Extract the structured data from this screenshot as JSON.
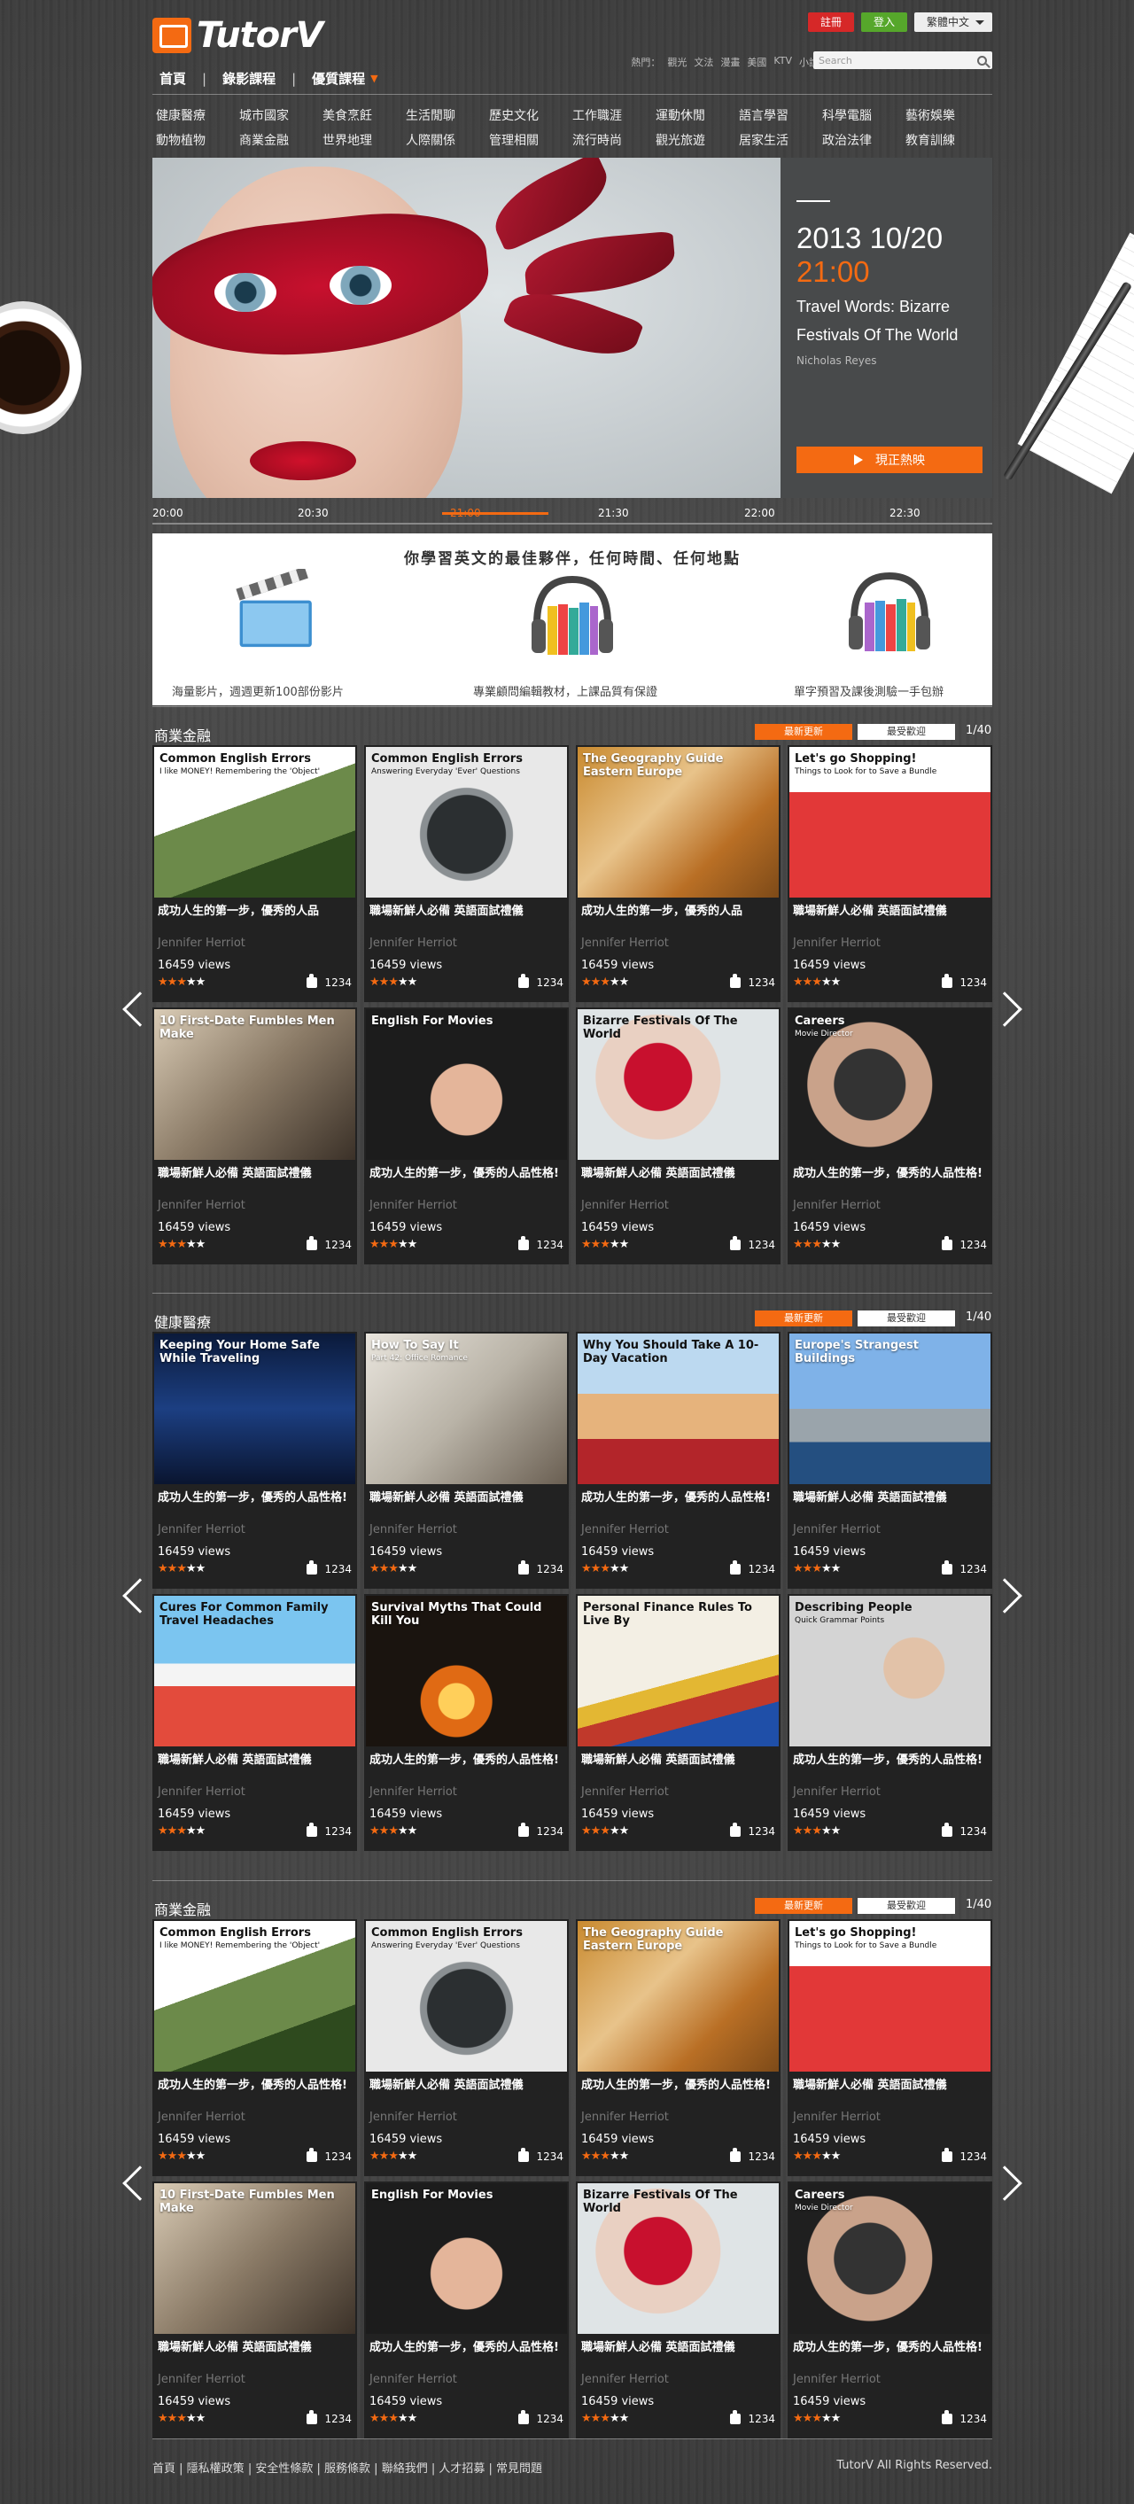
{
  "brand": {
    "name": "TutorV"
  },
  "header": {
    "register": "註冊",
    "login": "登入",
    "language": "繁體中文",
    "nav": [
      "首頁",
      "錄影課程",
      "優質課程"
    ],
    "hot_label": "熱門：",
    "hot_links": [
      "觀光",
      "文法",
      "漫畫",
      "美國",
      "KTV",
      "小說"
    ],
    "search_placeholder": "Search"
  },
  "categories": [
    "健康醫療",
    "城市國家",
    "美食烹飪",
    "生活閒聊",
    "歷史文化",
    "工作職涯",
    "運動休閒",
    "語言學習",
    "科學電腦",
    "藝術娛樂",
    "動物植物",
    "商業金融",
    "世界地理",
    "人際關係",
    "管理相關",
    "流行時尚",
    "觀光旅遊",
    "居家生活",
    "政治法律",
    "教育訓練"
  ],
  "hero": {
    "date": "2013 10/20",
    "time": "21:00",
    "title": "Travel Words: Bizarre Festivals Of The World",
    "author": "Nicholas Reyes",
    "button": "現正熱映",
    "timeline": [
      "20:00",
      "20:30",
      "21:00",
      "21:30",
      "22:00",
      "22:30"
    ],
    "timeline_active": 2
  },
  "banner": {
    "title": "你學習英文的最佳夥伴，任何時間、任何地點",
    "features": [
      "海量影片，週週更新100部份影片",
      "專業顧問編輯教材，上課品質有保證",
      "單字預習及課後測驗一手包辦"
    ]
  },
  "tabs": {
    "latest": "最新更新",
    "popular": "最受歡迎",
    "pager": "1/40"
  },
  "card_common": {
    "desc_a": "成功人生的第一步，優秀的人品性格!",
    "desc_b": "職場新鮮人必備 英語面試禮儀",
    "author": "Jennifer Herriot",
    "views": "16459 views",
    "likes": "1234",
    "rating": 3
  },
  "sections": [
    {
      "title": "商業金融",
      "cards": [
        {
          "title": "Common English Errors",
          "sub": "I like MONEY! Remembering the 'Object'",
          "desc": "成功人生的第一步，優秀的人品",
          "theme": "wave",
          "dark": true
        },
        {
          "title": "Common English Errors",
          "sub": "Answering Everyday 'Ever' Questions",
          "desc": "職場新鮮人必備 英語面試禮儀",
          "theme": "clock",
          "dark": true
        },
        {
          "title": "The Geography Guide Eastern Europe",
          "sub": "",
          "desc": "成功人生的第一步，優秀的人品",
          "theme": "map",
          "dark": false
        },
        {
          "title": "Let's go Shopping!",
          "sub": "Things to Look for to Save a Bundle",
          "desc": "職場新鮮人必備 英語面試禮儀",
          "theme": "shop",
          "dark": true
        },
        {
          "title": "10 First-Date Fumbles Men Make",
          "sub": "",
          "desc": "職場新鮮人必備 英語面試禮儀",
          "theme": "date",
          "dark": false
        },
        {
          "title": "English For Movies",
          "sub": "",
          "desc": "成功人生的第一步，優秀的人品性格!",
          "theme": "movie",
          "dark": false
        },
        {
          "title": "Bizarre Festivals Of The World",
          "sub": "",
          "desc": "職場新鮮人必備 英語面試禮儀",
          "theme": "mask",
          "dark": true
        },
        {
          "title": "Careers",
          "sub": "Movie Director",
          "desc": "成功人生的第一步，優秀的人品性格!",
          "theme": "camera",
          "dark": false
        }
      ]
    },
    {
      "title": "健康醫療",
      "cards": [
        {
          "title": "Keeping Your Home Safe While Traveling",
          "sub": "",
          "desc": "成功人生的第一步，優秀的人品性格!",
          "theme": "night",
          "dark": false
        },
        {
          "title": "How To Say It",
          "sub": "Part 42: Office Romance",
          "desc": "職場新鮮人必備 英語面試禮儀",
          "theme": "office",
          "dark": false
        },
        {
          "title": "Why You Should Take A 10-Day Vacation",
          "sub": "",
          "desc": "成功人生的第一步，優秀的人品性格!",
          "theme": "car",
          "dark": true
        },
        {
          "title": "Europe's Strangest Buildings",
          "sub": "",
          "desc": "職場新鮮人必備 英語面試禮儀",
          "theme": "building",
          "dark": false
        },
        {
          "title": "Cures For Common Family Travel Headaches",
          "sub": "",
          "desc": "職場新鮮人必備 英語面試禮儀",
          "theme": "family",
          "dark": true
        },
        {
          "title": "Survival Myths That Could Kill You",
          "sub": "",
          "desc": "成功人生的第一步，優秀的人品性格!",
          "theme": "fire",
          "dark": false
        },
        {
          "title": "Personal Finance Rules To Live By",
          "sub": "",
          "desc": "職場新鮮人必備 英語面試禮儀",
          "theme": "chart",
          "dark": true
        },
        {
          "title": "Describing People",
          "sub": "Quick Grammar Points",
          "desc": "成功人生的第一步，優秀的人品性格!",
          "theme": "man",
          "dark": true
        }
      ]
    },
    {
      "title": "商業金融",
      "cards": [
        {
          "title": "Common English Errors",
          "sub": "I like MONEY! Remembering the 'Object'",
          "desc": "成功人生的第一步，優秀的人品性格!",
          "theme": "wave",
          "dark": true
        },
        {
          "title": "Common English Errors",
          "sub": "Answering Everyday 'Ever' Questions",
          "desc": "職場新鮮人必備 英語面試禮儀",
          "theme": "clock",
          "dark": true
        },
        {
          "title": "The Geography Guide Eastern Europe",
          "sub": "",
          "desc": "成功人生的第一步，優秀的人品性格!",
          "theme": "map",
          "dark": false
        },
        {
          "title": "Let's go Shopping!",
          "sub": "Things to Look for to Save a Bundle",
          "desc": "職場新鮮人必備 英語面試禮儀",
          "theme": "shop",
          "dark": true
        },
        {
          "title": "10 First-Date Fumbles Men Make",
          "sub": "",
          "desc": "職場新鮮人必備 英語面試禮儀",
          "theme": "date",
          "dark": false
        },
        {
          "title": "English For Movies",
          "sub": "",
          "desc": "成功人生的第一步，優秀的人品性格!",
          "theme": "movie",
          "dark": false
        },
        {
          "title": "Bizarre Festivals Of The World",
          "sub": "",
          "desc": "職場新鮮人必備 英語面試禮儀",
          "theme": "mask",
          "dark": true
        },
        {
          "title": "Careers",
          "sub": "Movie Director",
          "desc": "成功人生的第一步，優秀的人品性格!",
          "theme": "camera",
          "dark": false
        }
      ]
    }
  ],
  "footer": {
    "links": [
      "首頁",
      "隱私權政策",
      "安全性條款",
      "服務條款",
      "聯絡我們",
      "人才招募",
      "常見問題"
    ],
    "copyright": "TutorV All Rights Reserved."
  },
  "colors": {
    "accent": "#f46a12",
    "register": "#d62828",
    "login": "#56a72b"
  }
}
